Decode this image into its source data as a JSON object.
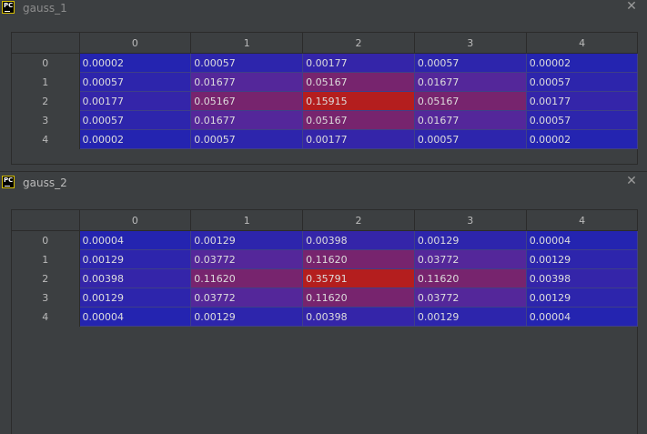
{
  "icons": {
    "app_icon_text": "PC"
  },
  "colors": {
    "low": "#2424b0",
    "mid": "#55279a",
    "high": "#b41e1e",
    "panel_bg": "#3c3f41"
  },
  "panels": [
    {
      "title": "gauss_1",
      "columns": [
        "0",
        "1",
        "2",
        "3",
        "4"
      ],
      "rows": [
        {
          "index": "0",
          "cells": [
            "0.00002",
            "0.00057",
            "0.00177",
            "0.00057",
            "0.00002"
          ]
        },
        {
          "index": "1",
          "cells": [
            "0.00057",
            "0.01677",
            "0.05167",
            "0.01677",
            "0.00057"
          ]
        },
        {
          "index": "2",
          "cells": [
            "0.00177",
            "0.05167",
            "0.15915",
            "0.05167",
            "0.00177"
          ]
        },
        {
          "index": "3",
          "cells": [
            "0.00057",
            "0.01677",
            "0.05167",
            "0.01677",
            "0.00057"
          ]
        },
        {
          "index": "4",
          "cells": [
            "0.00002",
            "0.00057",
            "0.00177",
            "0.00057",
            "0.00002"
          ]
        }
      ]
    },
    {
      "title": "gauss_2",
      "columns": [
        "0",
        "1",
        "2",
        "3",
        "4"
      ],
      "rows": [
        {
          "index": "0",
          "cells": [
            "0.00004",
            "0.00129",
            "0.00398",
            "0.00129",
            "0.00004"
          ]
        },
        {
          "index": "1",
          "cells": [
            "0.00129",
            "0.03772",
            "0.11620",
            "0.03772",
            "0.00129"
          ]
        },
        {
          "index": "2",
          "cells": [
            "0.00398",
            "0.11620",
            "0.35791",
            "0.11620",
            "0.00398"
          ]
        },
        {
          "index": "3",
          "cells": [
            "0.00129",
            "0.03772",
            "0.11620",
            "0.03772",
            "0.00129"
          ]
        },
        {
          "index": "4",
          "cells": [
            "0.00004",
            "0.00129",
            "0.00398",
            "0.00129",
            "0.00004"
          ]
        }
      ]
    }
  ]
}
